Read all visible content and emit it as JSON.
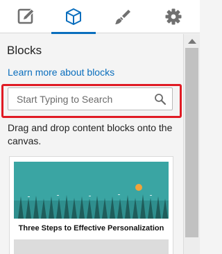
{
  "tabs": [
    {
      "label": "Edit",
      "icon": "pencil-icon",
      "active": false
    },
    {
      "label": "Blocks",
      "icon": "cube-icon",
      "active": true
    },
    {
      "label": "Style",
      "icon": "paintbrush-icon",
      "active": false
    },
    {
      "label": "Settings",
      "icon": "gear-icon",
      "active": false
    }
  ],
  "panel": {
    "title": "Blocks",
    "learn_link": "Learn more about blocks",
    "search_placeholder": "Start Typing to Search",
    "help_text": "Drag and drop content blocks onto the canvas."
  },
  "block_card": {
    "caption": "Three Steps to Effective Personalization"
  },
  "colors": {
    "accent": "#0a6ebd",
    "highlight": "#e01b24",
    "icon_gray": "#707070"
  }
}
